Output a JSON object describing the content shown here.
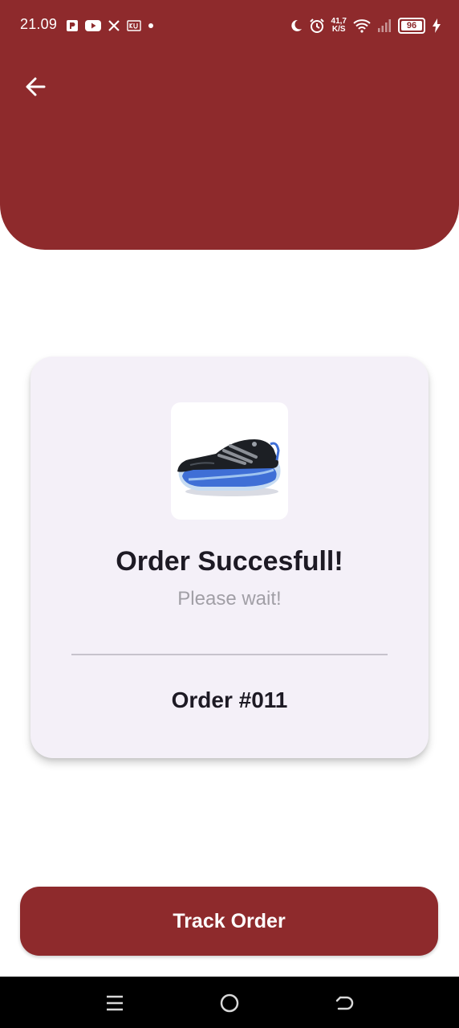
{
  "status_bar": {
    "time": "21.09",
    "network_speed_top": "41,7",
    "network_speed_unit": "K/S",
    "battery": "96",
    "left_icons": [
      "p-icon",
      "youtube-icon",
      "x-icon",
      "kuk-icon",
      "dot-icon"
    ],
    "right_icons": [
      "moon-icon",
      "alarm-icon",
      "wifi-icon",
      "signal-icon",
      "battery-icon",
      "charging-icon"
    ]
  },
  "header": {
    "back_icon": "arrow-left-icon"
  },
  "card": {
    "title": "Order Succesfull!",
    "subtitle": "Please wait!",
    "order_number": "Order #011",
    "product_image": "running-shoe-image"
  },
  "actions": {
    "track_order_label": "Track Order"
  },
  "nav_bar": {
    "icons": [
      "menu-icon",
      "home-icon",
      "back-icon"
    ]
  },
  "colors": {
    "primary": "#8e2a2c",
    "card_bg": "#f4f0f8",
    "text_dark": "#1d1a24",
    "text_muted": "#a19fa6"
  }
}
